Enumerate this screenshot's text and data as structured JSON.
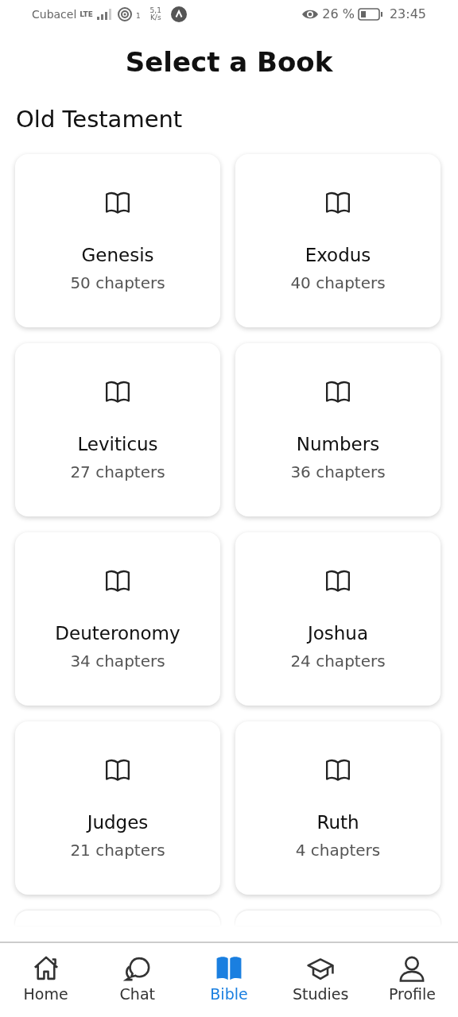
{
  "status_bar": {
    "carrier": "Cubacel",
    "network": "LTE",
    "hotspot_count": "1",
    "speed_value": "5,1",
    "speed_unit": "K/s",
    "battery": "26 %",
    "time": "23:45"
  },
  "title": "Select a Book",
  "section": "Old Testament",
  "books": [
    {
      "kind": "book",
      "name": "Genesis",
      "chapters": "50 chapters"
    },
    {
      "kind": "book",
      "name": "Exodus",
      "chapters": "40 chapters"
    },
    {
      "kind": "book",
      "name": "Leviticus",
      "chapters": "27 chapters"
    },
    {
      "kind": "book",
      "name": "Numbers",
      "chapters": "36 chapters"
    },
    {
      "kind": "book",
      "name": "Deuteronomy",
      "chapters": "34 chapters"
    },
    {
      "kind": "book",
      "name": "Joshua",
      "chapters": "24 chapters"
    },
    {
      "kind": "book",
      "name": "Judges",
      "chapters": "21 chapters"
    },
    {
      "kind": "book",
      "name": "Ruth",
      "chapters": "4 chapters"
    },
    {
      "kind": "cut"
    },
    {
      "kind": "cut"
    }
  ],
  "tabs": [
    {
      "label": "Home",
      "kind": "home",
      "selected": false
    },
    {
      "label": "Chat",
      "kind": "chat",
      "selected": false
    },
    {
      "label": "Bible",
      "kind": "book",
      "selected": true
    },
    {
      "label": "Studies",
      "kind": "cap",
      "selected": false
    },
    {
      "label": "Profile",
      "kind": "person",
      "selected": false
    }
  ]
}
